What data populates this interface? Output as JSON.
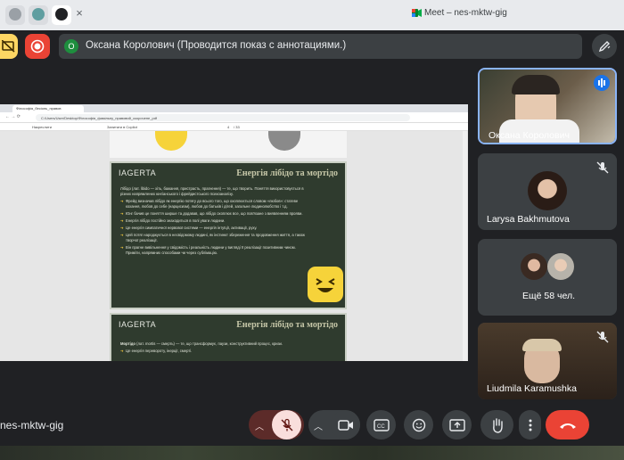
{
  "browser": {
    "meet_tab_title": "Meet – nes-mktw-gig",
    "close_glyph": "×"
  },
  "meeting": {
    "presenter_initial": "О",
    "presenter_text": "Оксана Королович (Проводится показ с аннотациями.)",
    "meeting_code": "nes-mktw-gig"
  },
  "shared_screen": {
    "tab_title": "Філософія_бесіонь_правов",
    "address": "C:/Users/User/Desktop/Філософія_фамільну_правовий_скорочене_pdf",
    "toolbar_items": [
      "Накреслити",
      "Зaпитати в Copilot"
    ],
    "page_number": "4",
    "page_total": "/ 33",
    "slide1": {
      "logo": "IAGERTA",
      "title": "Енергія лібідо та мортідо",
      "intro": "Лібідо (лат. libido — хіть, бажання, пристрасть, прагнення) — те, що творить. Поняття використовується в різних напрямлених юнгіанського і фрейдистського психоаналізу.",
      "bullets": [
        "Фрейд визначав лібідо як енергію потягу до всього того, що охоплюється словом «любов»: статеве кохання, любов до себе (нарцисизм), любов до батьків і дітей, загальне людинолюбство і т.д.",
        "Юнг бачив це поняття ширше та додавав, що лібідо охоплює все, що пов'язане з виявленням прояви.",
        "Енергія лібідо постійно знаходиться в полі уваги людини.",
        "Це енергія симпатичної нервової системи — енергія інтуїції, активації, руху.",
        "Цей потяг народжується в несвідомому людині, як інстинкт збереження та продовження життя, а також творчої реалізації.",
        "Він прагне вивільнення у свідомість і реальність людини у вигляді її реалізації позитивним чином. Приміти, напрямних способами чи через сублімацію."
      ]
    },
    "slide2": {
      "logo": "IAGERTA",
      "title": "Енергія лібідо та мортідо",
      "intro_bold": "Мортідо",
      "intro": " (лат. mortis — смерть) — те, що трансформує, паузи, конструктивний процес, кризи.",
      "bullet": "Це енергія перевороту, інерції, смерті."
    }
  },
  "participants": [
    {
      "name": "Оксана Королович",
      "speaking": true
    },
    {
      "name": "Larysa Bakhmutova",
      "muted": true
    },
    {
      "name": "Ещё 58 чел.",
      "muted": true
    },
    {
      "name": "Liudmila Karamushka",
      "muted": true
    }
  ],
  "colors": {
    "background": "#202124",
    "surface": "#3c4043",
    "end_call": "#ea4335",
    "mic_off": "#f9dedc",
    "hand_yellow": "#fdd663",
    "accent_blue": "#8ab4f8"
  }
}
